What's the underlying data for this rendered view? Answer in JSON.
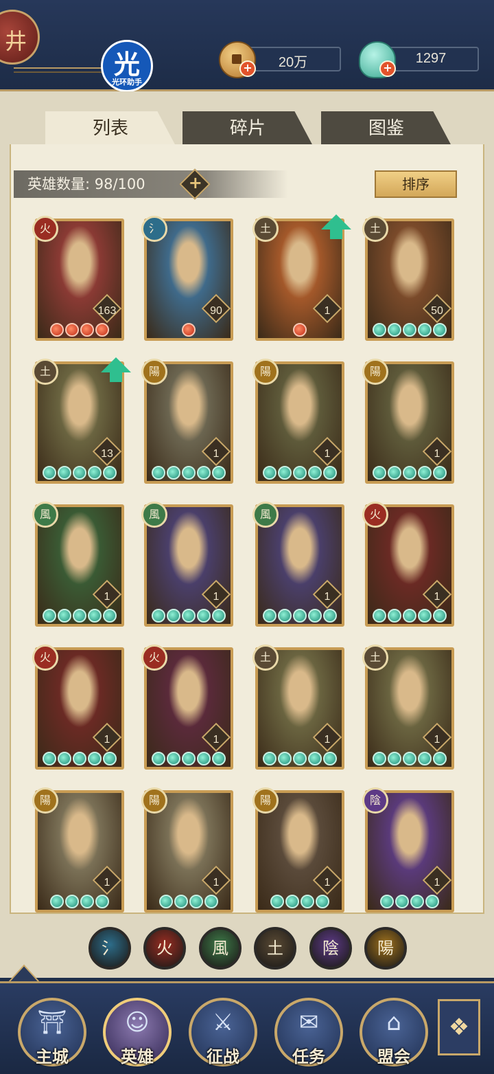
{
  "header": {
    "app_badge_text": "光",
    "app_badge_sub": "光环助手",
    "left_badge_glyph": "井",
    "coins": "20万",
    "jade": "1297",
    "plus": "+"
  },
  "tabs": [
    {
      "label": "列表",
      "active": true
    },
    {
      "label": "碎片",
      "active": false
    },
    {
      "label": "图鉴",
      "active": false
    }
  ],
  "hero_count": {
    "label": "英雄数量: 98/100",
    "add_symbol": "+"
  },
  "sort_button": "排序",
  "element_glyphs": {
    "water": "氵",
    "fire": "火",
    "wind": "風",
    "earth": "土",
    "yin": "陰",
    "yang": "陽"
  },
  "element_colors": {
    "water": "#2d6d8a",
    "fire": "#9a2d22",
    "wind": "#3e7a48",
    "earth": "#5a4a34",
    "yin": "#5d3a86",
    "yang": "#a0721d"
  },
  "heroes": [
    {
      "element": "fire",
      "level": "163",
      "stars": 4,
      "star_color": "red",
      "upgrade": false,
      "portrait_color": "#8a3a34"
    },
    {
      "element": "water",
      "level": "90",
      "stars": 1,
      "star_color": "red",
      "upgrade": false,
      "portrait_color": "#3f6a8a"
    },
    {
      "element": "earth",
      "level": "1",
      "stars": 1,
      "star_color": "red",
      "upgrade": true,
      "portrait_color": "#a3582a"
    },
    {
      "element": "earth",
      "level": "50",
      "stars": 5,
      "star_color": "green",
      "upgrade": false,
      "portrait_color": "#7a4a2a"
    },
    {
      "element": "earth",
      "level": "13",
      "stars": 5,
      "star_color": "green",
      "upgrade": true,
      "portrait_color": "#6a6440"
    },
    {
      "element": "yang",
      "level": "1",
      "stars": 5,
      "star_color": "green",
      "upgrade": false,
      "portrait_color": "#6b6550"
    },
    {
      "element": "yang",
      "level": "1",
      "stars": 5,
      "star_color": "green",
      "upgrade": false,
      "portrait_color": "#5e5a3a"
    },
    {
      "element": "yang",
      "level": "1",
      "stars": 5,
      "star_color": "green",
      "upgrade": false,
      "portrait_color": "#5e5a3a"
    },
    {
      "element": "wind",
      "level": "1",
      "stars": 5,
      "star_color": "green",
      "upgrade": false,
      "portrait_color": "#3a5a34"
    },
    {
      "element": "wind",
      "level": "1",
      "stars": 5,
      "star_color": "green",
      "upgrade": false,
      "portrait_color": "#4a3f6a"
    },
    {
      "element": "wind",
      "level": "1",
      "stars": 5,
      "star_color": "green",
      "upgrade": false,
      "portrait_color": "#4a3f6a"
    },
    {
      "element": "fire",
      "level": "1",
      "stars": 5,
      "star_color": "green",
      "upgrade": false,
      "portrait_color": "#6a2a24"
    },
    {
      "element": "fire",
      "level": "1",
      "stars": 5,
      "star_color": "green",
      "upgrade": false,
      "portrait_color": "#6a2a24"
    },
    {
      "element": "fire",
      "level": "1",
      "stars": 5,
      "star_color": "green",
      "upgrade": false,
      "portrait_color": "#5a2a3a"
    },
    {
      "element": "earth",
      "level": "1",
      "stars": 5,
      "star_color": "green",
      "upgrade": false,
      "portrait_color": "#6a6440"
    },
    {
      "element": "earth",
      "level": "1",
      "stars": 5,
      "star_color": "green",
      "upgrade": false,
      "portrait_color": "#6a6440"
    },
    {
      "element": "yang",
      "level": "1",
      "stars": 4,
      "star_color": "green",
      "upgrade": false,
      "portrait_color": "#7a7056"
    },
    {
      "element": "yang",
      "level": "1",
      "stars": 4,
      "star_color": "green",
      "upgrade": false,
      "portrait_color": "#7a7056"
    },
    {
      "element": "yang",
      "level": "1",
      "stars": 4,
      "star_color": "green",
      "upgrade": false,
      "portrait_color": "#5a4a3a"
    },
    {
      "element": "yin",
      "level": "1",
      "stars": 4,
      "star_color": "green",
      "upgrade": false,
      "portrait_color": "#5a3a7a"
    }
  ],
  "filters": [
    "water",
    "fire",
    "wind",
    "earth",
    "yin",
    "yang"
  ],
  "bottom_nav": [
    {
      "label": "主城",
      "icon": "city-gate-icon",
      "glyph": "⛩",
      "active": false
    },
    {
      "label": "英雄",
      "icon": "hero-icon",
      "glyph": "☺",
      "active": true
    },
    {
      "label": "征战",
      "icon": "battle-icon",
      "glyph": "⚔",
      "active": false
    },
    {
      "label": "任务",
      "icon": "task-scroll-icon",
      "glyph": "✉",
      "active": false
    },
    {
      "label": "盟会",
      "icon": "alliance-icon",
      "glyph": "⌂",
      "active": false
    }
  ],
  "menu_glyph": "❖"
}
